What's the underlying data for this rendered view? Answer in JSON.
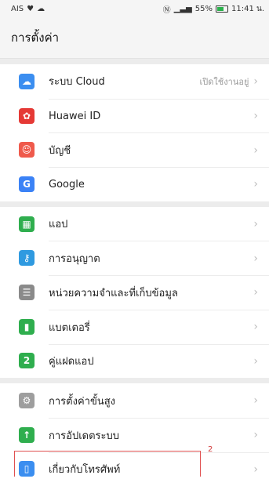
{
  "status": {
    "carrier": "AIS",
    "signal": "📶",
    "battery": "55%",
    "time": "11:41 น."
  },
  "header": {
    "title": "การตั้งค่า"
  },
  "groups": [
    {
      "items": [
        {
          "label": "ระบบ Cloud",
          "value": "เปิดใช้งานอยู่",
          "icon": "cloud-icon",
          "color": "#3b8ef0"
        },
        {
          "label": "Huawei ID",
          "icon": "huawei-icon",
          "color": "#e53935"
        },
        {
          "label": "บัญชี",
          "icon": "account-icon",
          "color": "#ef5a4c"
        },
        {
          "label": "Google",
          "icon": "google-icon",
          "color": "#3b82f6"
        }
      ]
    },
    {
      "items": [
        {
          "label": "แอป",
          "icon": "apps-icon",
          "color": "#2fae4e"
        },
        {
          "label": "การอนุญาต",
          "icon": "permissions-icon",
          "color": "#2f9ae0"
        },
        {
          "label": "หน่วยความจำและที่เก็บข้อมูล",
          "icon": "storage-icon",
          "color": "#8a8a8a"
        },
        {
          "label": "แบตเตอรี่",
          "icon": "battery-icon",
          "color": "#2fae4e"
        },
        {
          "label": "คู่แฝดแอป",
          "icon": "app-twin-icon",
          "color": "#2fae4e"
        }
      ]
    },
    {
      "items": [
        {
          "label": "การตั้งค่าขั้นสูง",
          "icon": "advanced-settings-icon",
          "color": "#9e9e9e"
        },
        {
          "label": "การอัปเดตระบบ",
          "icon": "system-update-icon",
          "color": "#2fae4e"
        },
        {
          "label": "เกี่ยวกับโทรศัพท์",
          "icon": "about-phone-icon",
          "color": "#3b8ef0"
        }
      ]
    }
  ],
  "annotation": {
    "number": "2"
  }
}
